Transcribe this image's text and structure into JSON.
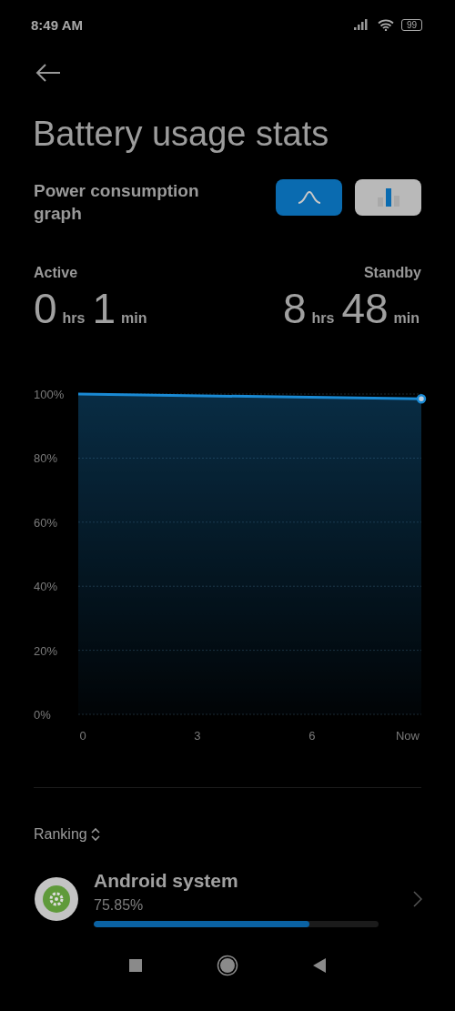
{
  "status_bar": {
    "time": "8:49 AM",
    "battery": "99"
  },
  "title": "Battery usage stats",
  "graph_header": {
    "label": "Power consumption graph",
    "modes": [
      {
        "kind": "line",
        "selected": true
      },
      {
        "kind": "bar",
        "selected": false
      }
    ]
  },
  "durations": [
    {
      "label": "Active",
      "hours": "0",
      "hours_unit": "hrs",
      "minutes": "1",
      "minutes_unit": "min"
    },
    {
      "label": "Standby",
      "hours": "8",
      "hours_unit": "hrs",
      "minutes": "48",
      "minutes_unit": "min"
    }
  ],
  "chart_data": {
    "type": "area",
    "x": [
      -0.12,
      8.86
    ],
    "series": [
      {
        "color": "#1a8ad4",
        "values": [
          100,
          98.5
        ]
      }
    ],
    "xlim": [
      -0.12,
      8.86
    ],
    "ylim": [
      0,
      100
    ],
    "grid": true,
    "xticks": [
      {
        "value": 0,
        "label": "0"
      },
      {
        "value": 3,
        "label": "3"
      },
      {
        "value": 6,
        "label": "6"
      },
      {
        "value": 8.5,
        "label": "Now"
      }
    ],
    "yticks": [
      {
        "value": 0,
        "label": "0%"
      },
      {
        "value": 20,
        "label": "20%"
      },
      {
        "value": 40,
        "label": "40%"
      },
      {
        "value": 60,
        "label": "60%"
      },
      {
        "value": 80,
        "label": "80%"
      },
      {
        "value": 100,
        "label": "100%"
      }
    ]
  },
  "ranking": {
    "label": "Ranking"
  },
  "apps": [
    {
      "name": "Android system",
      "percent": "75.85%",
      "level": 0.7585
    }
  ]
}
